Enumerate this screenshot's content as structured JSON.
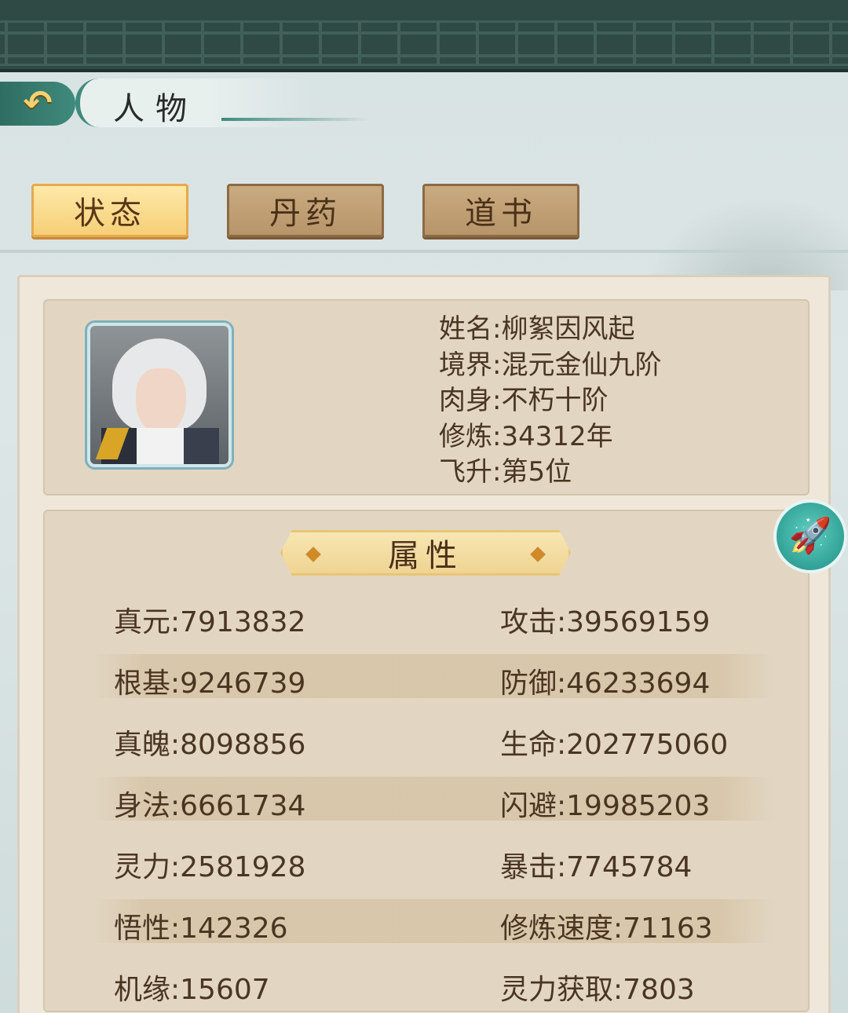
{
  "header": {
    "title": "人物",
    "back_glyph": "↶"
  },
  "tabs": [
    {
      "label": "状态",
      "active": true
    },
    {
      "label": "丹药",
      "active": false
    },
    {
      "label": "道书",
      "active": false
    }
  ],
  "profile": {
    "name": "姓名:柳絮因风起",
    "realm": "境界:混元金仙九阶",
    "body": "肉身:不朽十阶",
    "cultivation": "修炼:34312年",
    "ascension": "飞升:第5位"
  },
  "attributes": {
    "title": "属性",
    "rows": [
      {
        "left": "真元:7913832",
        "right": "攻击:39569159"
      },
      {
        "left": "根基:9246739",
        "right": "防御:46233694"
      },
      {
        "left": "真魄:8098856",
        "right": "生命:202775060"
      },
      {
        "left": "身法:6661734",
        "right": "闪避:19985203"
      },
      {
        "left": "灵力:2581928",
        "right": "暴击:7745784"
      },
      {
        "left": "悟性:142326",
        "right": "修炼速度:71163"
      },
      {
        "left": "机缘:15607",
        "right": "灵力获取:7803"
      }
    ]
  },
  "icons": {
    "back": "back-arrow-icon",
    "rocket": "rocket-icon",
    "rocket_glyph": "🚀"
  },
  "colors": {
    "accent_teal": "#3f8a7c",
    "tab_active": "#f6cf78",
    "tab_inactive": "#b8956a",
    "panel": "#efe7da",
    "text": "#4a3522"
  }
}
